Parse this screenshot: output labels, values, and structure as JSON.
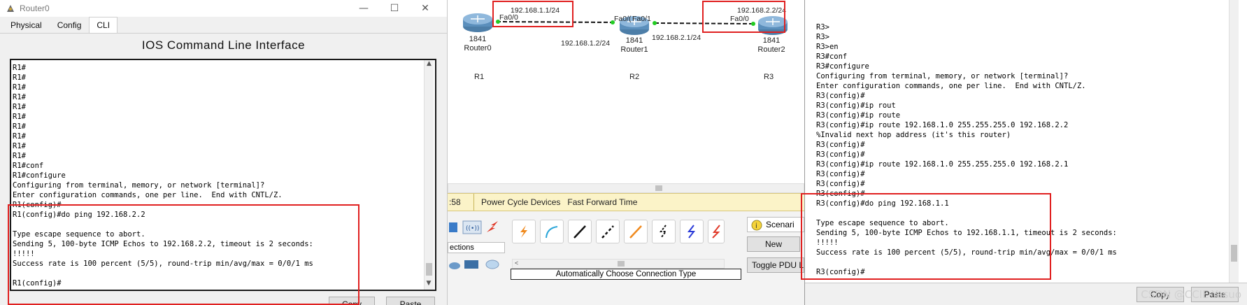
{
  "left_window": {
    "title": "Router0",
    "controls": {
      "minimize": "—",
      "maximize": "☐",
      "close": "✕"
    },
    "tabs": [
      {
        "label": "Physical"
      },
      {
        "label": "Config"
      },
      {
        "label": "CLI"
      }
    ],
    "cli_title": "IOS Command Line Interface",
    "terminal_lines": [
      "R1#",
      "R1#",
      "R1#",
      "R1#",
      "R1#",
      "R1#",
      "R1#",
      "R1#",
      "R1#",
      "R1#",
      "R1#conf",
      "R1#configure",
      "Configuring from terminal, memory, or network [terminal]?",
      "Enter configuration commands, one per line.  End with CNTL/Z.",
      "R1(config)#",
      "R1(config)#do ping 192.168.2.2",
      "",
      "Type escape sequence to abort.",
      "Sending 5, 100-byte ICMP Echos to 192.168.2.2, timeout is 2 seconds:",
      "!!!!!",
      "Success rate is 100 percent (5/5), round-trip min/avg/max = 0/0/1 ms",
      "",
      "R1(config)#"
    ],
    "buttons": {
      "copy": "Copy",
      "paste": "Paste"
    }
  },
  "topology": {
    "routers": [
      {
        "model": "1841",
        "name": "Router0",
        "tag": "R1"
      },
      {
        "model": "1841",
        "name": "Router1",
        "tag": "R2"
      },
      {
        "model": "1841",
        "name": "Router2",
        "tag": "R3"
      }
    ],
    "interfaces": {
      "r0_fa00": "Fa0/0",
      "r1_fa00": "Fa0/(",
      "r1_fa01": "Fa0/1",
      "r2_fa00": "Fa0/0"
    },
    "addresses": {
      "r0": "192.168.1.1/24",
      "r1_left": "192.168.1.2/24",
      "r1_right": "192.168.2.1/24",
      "r2": "192.168.2.2/24"
    }
  },
  "pt_bar": {
    "timer": ":58",
    "power_cycle": "Power Cycle Devices",
    "fast_forward": "Fast Forward Time"
  },
  "pt_lower": {
    "category_label": "ections",
    "connection_type": "Automatically Choose Connection Type",
    "scenario_label": "Scenari",
    "new_button": "New",
    "toggle_pdu": "Toggle PDU L"
  },
  "right_window": {
    "terminal_lines": [
      "R3>",
      "R3>",
      "R3>en",
      "R3#conf",
      "R3#configure",
      "Configuring from terminal, memory, or network [terminal]?",
      "Enter configuration commands, one per line.  End with CNTL/Z.",
      "R3(config)#",
      "R3(config)#ip rout",
      "R3(config)#ip route",
      "R3(config)#ip route 192.168.1.0 255.255.255.0 192.168.2.2",
      "%Invalid next hop address (it's this router)",
      "R3(config)#",
      "R3(config)#",
      "R3(config)#ip route 192.168.1.0 255.255.255.0 192.168.2.1",
      "R3(config)#",
      "R3(config)#",
      "R3(config)#",
      "R3(config)#do ping 192.168.1.1",
      "",
      "Type escape sequence to abort.",
      "Sending 5, 100-byte ICMP Echos to 192.168.1.1, timeout is 2 seconds:",
      "!!!!!",
      "Success rate is 100 percent (5/5), round-trip min/avg/max = 0/0/1 ms",
      "",
      "R3(config)#"
    ],
    "buttons": {
      "copy": "Copy",
      "paste": "Paste"
    },
    "watermark": "CSDN @CCIE-Yasuo"
  },
  "colors": {
    "highlight": "#e02020",
    "link_dot": "#22cc22",
    "bar_bg": "#fbf3c8"
  }
}
